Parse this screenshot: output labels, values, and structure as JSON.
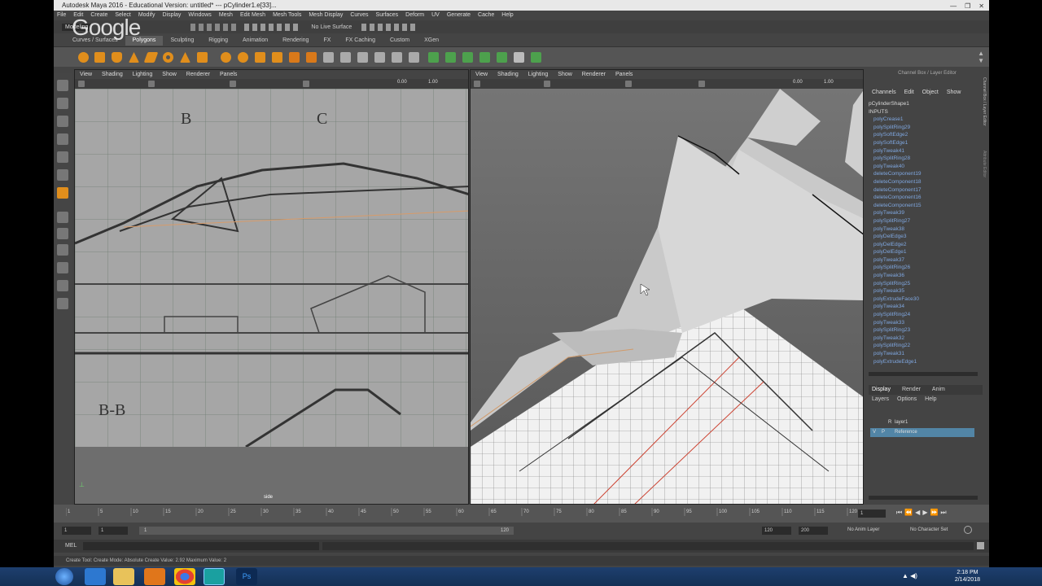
{
  "window": {
    "title": "Autodesk Maya 2016 - Educational Version: untitled*    ---    pCylinder1.e[33]...",
    "controls": [
      "—",
      "❐",
      "✕"
    ]
  },
  "watermark": "Google",
  "menubar": [
    "File",
    "Edit",
    "Create",
    "Select",
    "Modify",
    "Display",
    "Windows",
    "Mesh",
    "Edit Mesh",
    "Mesh Tools",
    "Mesh Display",
    "Curves",
    "Surfaces",
    "Deform",
    "UV",
    "Generate",
    "Cache",
    "Help"
  ],
  "statusline": {
    "live_surface": "No Live Surface",
    "mode": "Modeling"
  },
  "shelf_tabs": [
    "Curves / Surfaces",
    "Polygons",
    "Sculpting",
    "Rigging",
    "Animation",
    "Rendering",
    "FX",
    "FX Caching",
    "Custom",
    "XGen"
  ],
  "shelf_tab_active": "Polygons",
  "viewport_menus": [
    "View",
    "Shading",
    "Lighting",
    "Show",
    "Renderer",
    "Panels"
  ],
  "viewport_values": {
    "left_a": "0.00",
    "left_b": "1.00",
    "right_a": "0.00",
    "right_b": "1.00"
  },
  "viewport_left_labels": {
    "b": "B",
    "c": "C",
    "bb": "B-B",
    "camera": "side"
  },
  "channel_box": {
    "header": "Channel Box / Layer Editor",
    "menu": [
      "Channels",
      "Edit",
      "Object",
      "Show"
    ],
    "shape": "pCylinderShape1",
    "inputs_label": "INPUTS",
    "inputs": [
      "polyCrease1",
      "polySplitRing29",
      "polySoftEdge2",
      "polySoftEdge1",
      "polyTweak41",
      "polySplitRing28",
      "polyTweak40",
      "deleteComponent19",
      "deleteComponent18",
      "deleteComponent17",
      "deleteComponent16",
      "deleteComponent15",
      "polyTweak39",
      "polySplitRing27",
      "polyTweak38",
      "polyDelEdge3",
      "polyDelEdge2",
      "polyDelEdge1",
      "polyTweak37",
      "polySplitRing26",
      "polyTweak36",
      "polySplitRing25",
      "polyTweak35",
      "polyExtrudeFace30",
      "polyTweak34",
      "polySplitRing24",
      "polyTweak33",
      "polySplitRing23",
      "polyTweak32",
      "polySplitRing22",
      "polyTweak31",
      "polyExtrudeEdge1"
    ],
    "side_tabs": [
      "Channel Box / Layer Editor",
      "Attribute Editor"
    ]
  },
  "layer_editor": {
    "tabs": [
      "Display",
      "Render",
      "Anim"
    ],
    "menu": [
      "Layers",
      "Options",
      "Help"
    ],
    "layers": [
      {
        "v": "",
        "r": "R",
        "name": "layer1",
        "selected": false
      },
      {
        "v": "V",
        "r": "P",
        "name": "Reference",
        "selected": true
      }
    ]
  },
  "timeline": {
    "ticks": [
      "1",
      "5",
      "10",
      "15",
      "20",
      "25",
      "30",
      "35",
      "40",
      "45",
      "50",
      "55",
      "60",
      "65",
      "70",
      "75",
      "80",
      "85",
      "90",
      "95",
      "100",
      "105",
      "110",
      "115",
      "120"
    ],
    "current_frame": "1"
  },
  "range": {
    "start": "1",
    "start2": "1",
    "slider_start": "1",
    "slider_end": "120",
    "end": "120",
    "end2": "200",
    "anim_layer": "No Anim Layer",
    "char_set": "No Character Set"
  },
  "mel_label": "MEL",
  "helpline": "Create Tool: Create Mode: Absolute   Create Value: 2.92   Maximum Value: 2",
  "taskbar": {
    "time": "2:18 PM",
    "date": "2/14/2018"
  },
  "colors": {
    "accent": "#5285a6",
    "selected_layer": "#5285a6",
    "ui_bg": "#444444",
    "orange_icon": "#d98c1a"
  }
}
